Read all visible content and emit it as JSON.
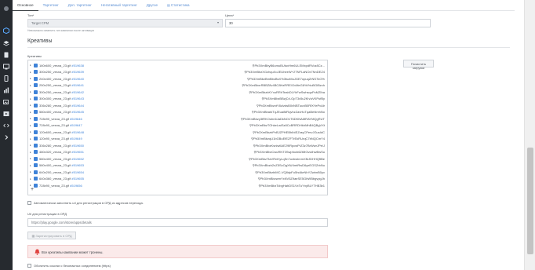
{
  "tabs": [
    {
      "label": "Основное",
      "active": true
    },
    {
      "label": "Таргетинг",
      "active": false
    },
    {
      "label": "Доп. таргетинг",
      "active": false
    },
    {
      "label": "Негативный таргетинг",
      "active": false
    },
    {
      "label": "Другое",
      "active": false
    },
    {
      "label": "Статистика",
      "active": false
    }
  ],
  "form": {
    "type_label": "Тип*",
    "type_value": "Target CPM",
    "type_hint": "Невозможно изменить тип кампании после активации",
    "price_label": "Цена*",
    "price_value": "30"
  },
  "creatives": {
    "section_title": "Креативы",
    "list_label": "Креативы",
    "clear_button": "Почистить загрузки",
    "rows": [
      {
        "file": "160x600_vesna_23.gif",
        "id": "#519638",
        "key": "Pb3XmBbyB6umuBUtuxHm6ULEMxpdRVoz8Cz..."
      },
      {
        "file": "300x250_vesna_23.gif",
        "id": "#519639",
        "key": "Pb3XmBbzXGzhquXoJEUheeW+2TNFLaNOx7NnDEZ4"
      },
      {
        "file": "240x400_vesna_23.gif",
        "id": "#519640",
        "key": "Pb3XmBbzBmBbcBsX%3fuzMuJGE7opuqZrNS7kO%"
      },
      {
        "file": "250x250_vesna_23.gif",
        "id": "#519641",
        "key": "Pb3XmBbxrRBBZ8v4BC8HzRRE/GvMeG6%/%uBGiBzch"
      },
      {
        "file": "300x250_vesna_23.gif",
        "id": "#519642",
        "key": "Pb3XmBbzbKYxuRRhTeabDLYbFwSwhsquPcMZIha"
      },
      {
        "file": "300x300_vesna_23.gif",
        "id": "#519643",
        "key": "Pb3XmBbzBBzjCrLGpT3x5u2Kh/uVKPufBy"
      },
      {
        "file": "336x280_vesna_23.gif",
        "id": "#519644",
        "key": "Pb3XmBbzxtY8zIzdsB0vNBTuuvB0RfXYePvAlr"
      },
      {
        "file": "580x400_vesna_23.gif",
        "id": "#519645",
        "key": "Pb3XmBbarkTqJEuaiMRqvhzZavHuTqaBehlmhNo"
      },
      {
        "file": "728x90_vesna_23.gif",
        "id": "#519646",
        "key": "Pb3XmBbzy3tRKOuhn6JaDkNO1T6DKNAMRAYMQgRUT"
      },
      {
        "file": "728x90_vesna_23.gif",
        "id": "#519647",
        "key": "Pb3XmBbzTOhkeLwiSz8CcBRRDHkhMhB4QBgVXt"
      },
      {
        "file": "120x600_vesna_23.gif",
        "id": "#519648",
        "key": "Pb3XmBbzbPvBJZPHEBhIbIEZrayCPervJGusIdC"
      },
      {
        "file": "120x90_vesna_23.gif",
        "id": "#519649",
        "key": "Pb3XmBbzqU1bGBuEfEZFTrEkRUrqC7bNQCmY4"
      },
      {
        "file": "336x280_vesna_23.gif",
        "id": "#519650",
        "key": "Pb3XmBbzKsnIwIlAE29lRpcwPrZ3z7BrWwrJPe/J"
      },
      {
        "file": "480x320_vesna_23.gif",
        "id": "#519651",
        "key": "Pb3XmBbzCwuRNT3Swpfocb6ZtMGvwIhwBwSu"
      },
      {
        "file": "580x400_vesna_23.gif",
        "id": "#519652",
        "key": "Pb3XmBbzTlaVRnHyLqSn7uvbwInrmXMJDHHQftBe"
      },
      {
        "file": "580x400_vesna_23.gif",
        "id": "#519653",
        "key": "Pb3XmBbzb2nZ5ScOgXN/4mtRwD6yeEGSZrbNu"
      },
      {
        "file": "640x200_vesna_23.gif",
        "id": "#519654",
        "key": "Pb3XmBbzbiMC-VQ8dpFu5hdAeNhYZwbnB0yv"
      },
      {
        "file": "640x360_vesna_23.gif",
        "id": "#519655",
        "key": "Pb3XmBbzwmYxNV5Z9aeSE5GbWBbgvpgJh"
      },
      {
        "file": "728x90_vesna_23.gif",
        "id": "#519656",
        "key": "Pb3XmBbzTcbgHahDS1VxTuYnyBLYTHB3b1"
      }
    ]
  },
  "auto_url_label": "Автоматически заполнить url для регистрации в ОРД из адресов перехода.",
  "ord_url_label": "Url для регистрации в ОРД",
  "ord_url_value": "https://play.google.com/store/apps/details",
  "register_button": "Зарегистрировать в ОРД",
  "alert_text": "Все креативы кампании может тронены.",
  "bottom_check_label": "Обогатить ссылки с безопасных соединением (https)"
}
